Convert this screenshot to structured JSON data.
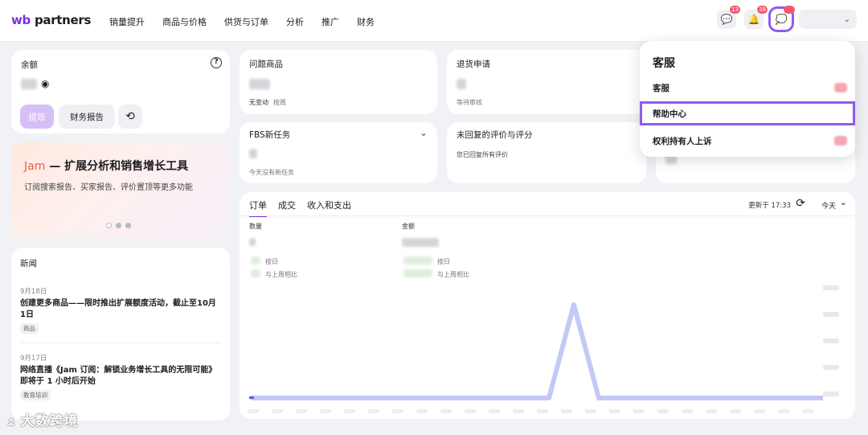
{
  "logo": {
    "prefix": "wb",
    "name": "partners"
  },
  "nav": [
    "销量提升",
    "商品与价格",
    "供货与订单",
    "分析",
    "推广",
    "财务"
  ],
  "top_icons": [
    {
      "name": "chat-icon",
      "glyph": "💬",
      "badge": "13"
    },
    {
      "name": "bell-icon",
      "glyph": "🔔",
      "badge": "38"
    },
    {
      "name": "support-icon",
      "glyph": "💭",
      "badge": ""
    }
  ],
  "profile": {
    "chevron": "⌄"
  },
  "balance": {
    "title": "余额",
    "help": "?",
    "withdraw": "提现",
    "report": "财务报告",
    "history_icon": "⟲"
  },
  "promo": {
    "jam": "Jam",
    "title": " — 扩展分析和销售增长工具",
    "subtitle": "订阅搜索报告、买家报告、评价置顶等更多功能"
  },
  "problem_goods": {
    "title": "问题商品",
    "sub1": "无变动",
    "sub2": "按周"
  },
  "returns": {
    "title": "退货申请",
    "sub": "等待审核"
  },
  "fbs": {
    "title": "FBS新任务",
    "sub": "今天没有新任务"
  },
  "reviews": {
    "title": "未回复的评价与评分",
    "sub": "您已回复所有评价"
  },
  "news": {
    "title": "新闻",
    "items": [
      {
        "date": "9月18日",
        "title": "创建更多商品——限时推出扩展额度活动，截止至10月1日",
        "tag": "商品"
      },
      {
        "date": "9月17日",
        "title": "网络直播《Jam 订阅：解锁业务增长工具的无限可能》即将于 1 小时后开始",
        "tag": "教育培训"
      }
    ]
  },
  "orders": {
    "tabs": [
      "订单",
      "成交",
      "收入和支出"
    ],
    "updated": "更新于 17:33",
    "period": "今天",
    "qty_label": "数量",
    "amount_label": "金额",
    "by_day": "按日",
    "vs_last_week": "与上周相比"
  },
  "dropdown": {
    "title": "客服",
    "items": [
      "客服",
      "帮助中心",
      "权利持有人上诉"
    ]
  },
  "watermark": "大数跨境",
  "colors": {
    "accent": "#7a2ee6",
    "highlight": "#8f5cf0",
    "badge": "#f05a70",
    "chart_line": "#b9bff5"
  }
}
